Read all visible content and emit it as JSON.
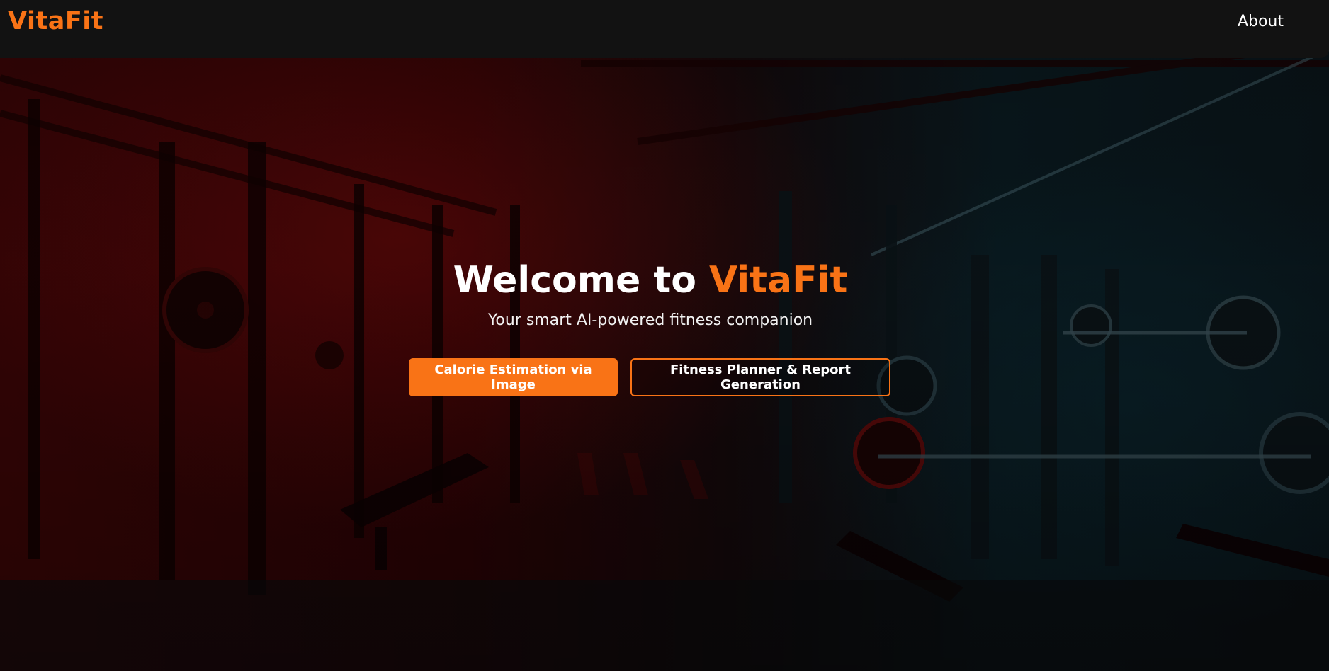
{
  "app": {
    "brand": "VitaFit"
  },
  "navbar": {
    "links": [
      {
        "label": "About"
      }
    ]
  },
  "hero": {
    "title_prefix": "Welcome to ",
    "title_accent": "VitaFit",
    "subtitle": "Your smart AI-powered fitness companion",
    "buttons": [
      {
        "label": "Calorie Estimation via Image",
        "style": "filled"
      },
      {
        "label": "Fitness Planner & Report Generation",
        "style": "outline"
      }
    ],
    "background_image": "gym-interior-image"
  },
  "colors": {
    "accent": "#f97316",
    "navbar_bg": "#121212",
    "text": "#ffffff"
  }
}
